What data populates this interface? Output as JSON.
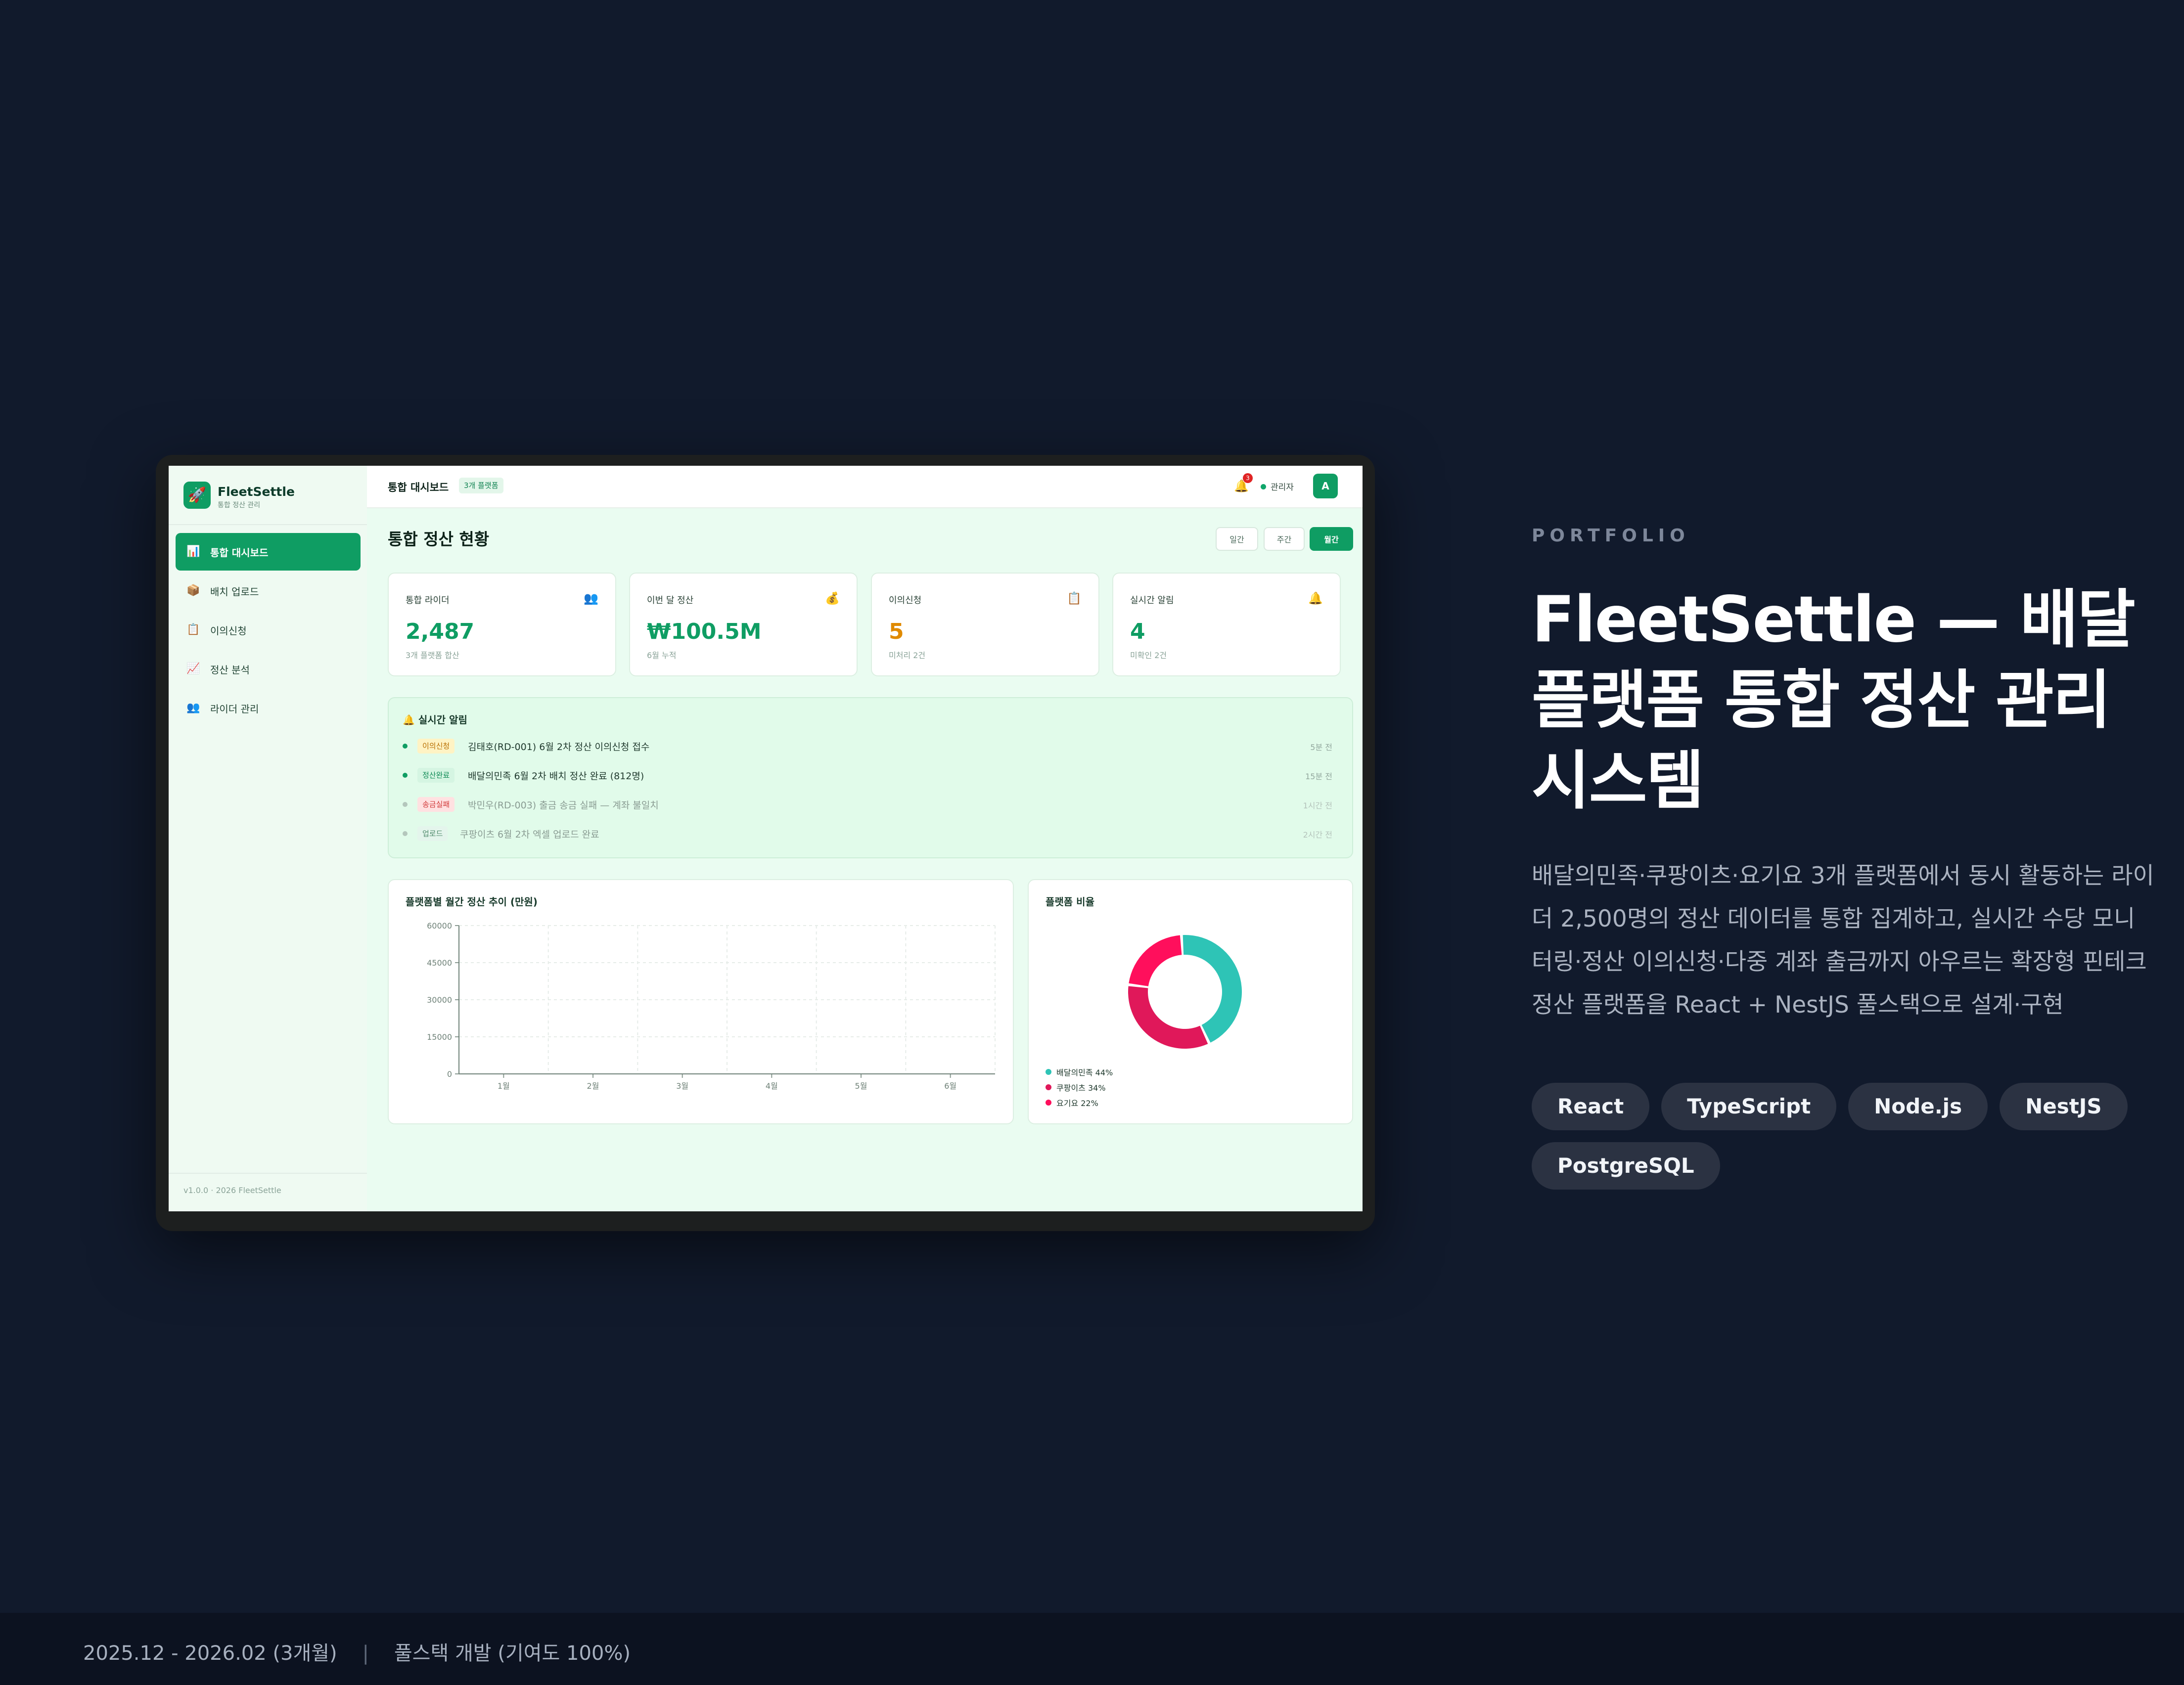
{
  "app": {
    "brand": {
      "name": "FleetSettle",
      "subtitle": "통합 정산 관리",
      "logo_icon": "rocket-icon"
    },
    "sidebar": {
      "items": [
        {
          "label": "통합 대시보드",
          "icon": "chart-icon",
          "active": true
        },
        {
          "label": "배치 업로드",
          "icon": "package-icon",
          "active": false
        },
        {
          "label": "이의신청",
          "icon": "clipboard-icon",
          "active": false
        },
        {
          "label": "정산 분석",
          "icon": "trend-icon",
          "active": false
        },
        {
          "label": "라이더 관리",
          "icon": "people-icon",
          "active": false
        }
      ],
      "footer": "v1.0.0 · 2026 FleetSettle"
    },
    "topbar": {
      "title": "통합 대시보드",
      "badge": "3개 플랫폼",
      "bell_count": "3",
      "user": "관리자",
      "avatar": "A"
    },
    "main": {
      "title": "통합 정산 현황",
      "periods": [
        "일간",
        "주간",
        "월간"
      ],
      "active_period": "월간",
      "cards": [
        {
          "label": "통합 라이더",
          "value": "2,487",
          "note": "3개 플랫폼 합산",
          "icon": "people-icon"
        },
        {
          "label": "이번 달 정산",
          "value": "₩100.5M",
          "note": "6월 누적",
          "icon": "money-bag-icon"
        },
        {
          "label": "이의신청",
          "value": "5",
          "note": "미처리 2건",
          "icon": "clipboard-icon"
        },
        {
          "label": "실시간 알림",
          "value": "4",
          "note": "미확인 2건",
          "icon": "bell-icon"
        }
      ],
      "alerts": {
        "title": "실시간 알림",
        "items": [
          {
            "tag": "이의신청",
            "text": "김태호(RD-001) 6월 2차 정산 이의신청 접수",
            "time": "5분 전"
          },
          {
            "tag": "정산완료",
            "text": "배달의민족 6월 2차 배치 정산 완료 (812명)",
            "time": "15분 전"
          },
          {
            "tag": "송금실패",
            "text": "박민우(RD-003) 출금 송금 실패 — 계좌 불일치",
            "time": "1시간 전"
          },
          {
            "tag": "업로드",
            "text": "쿠팡이츠 6월 2차 엑셀 업로드 완료",
            "time": "2시간 전"
          }
        ]
      }
    },
    "colors": {
      "accent": "#0f9d63",
      "warning": "#e08a00",
      "danger": "#e11d48"
    }
  },
  "chart_data": [
    {
      "type": "line",
      "title": "플랫폼별 월간 정산 추이 (만원)",
      "categories": [
        "1월",
        "2월",
        "3월",
        "4월",
        "5월",
        "6월"
      ],
      "series": [],
      "ylim": [
        0,
        60000
      ],
      "yticks": [
        0,
        15000,
        30000,
        45000,
        60000
      ],
      "grid": true
    },
    {
      "type": "pie",
      "title": "플랫폼 비율",
      "donut": true,
      "slices": [
        {
          "name": "배달의민족",
          "value": 44,
          "label": "배달의민족 44%",
          "color": "#2ec4b6"
        },
        {
          "name": "쿠팡이츠",
          "value": 34,
          "label": "쿠팡이츠 34%",
          "color": "#e0185a"
        },
        {
          "name": "요기요",
          "value": 22,
          "label": "요기요 22%",
          "color": "#ff0f5c"
        }
      ],
      "legend": "bottom-left"
    }
  ],
  "portfolio": {
    "eyebrow": "PORTFOLIO",
    "headline": "FleetSettle — 배달 플랫폼 통합 정산 관리 시스템",
    "description": "배달의민족·쿠팡이츠·요기요 3개 플랫폼에서 동시 활동하는 라이더 2,500명의 정산 데이터를 통합 집계하고, 실시간 수당 모니터링·정산 이의신청·다중 계좌 출금까지 아우르는 확장형 핀테크 정산 플랫폼을 React + NestJS 풀스택으로 설계·구현",
    "tags": [
      "React",
      "TypeScript",
      "Node.js",
      "NestJS",
      "PostgreSQL"
    ]
  },
  "footer": {
    "period": "2025.12 - 2026.02 (3개월)",
    "separator": "|",
    "role": "풀스택 개발 (기여도 100%)"
  }
}
